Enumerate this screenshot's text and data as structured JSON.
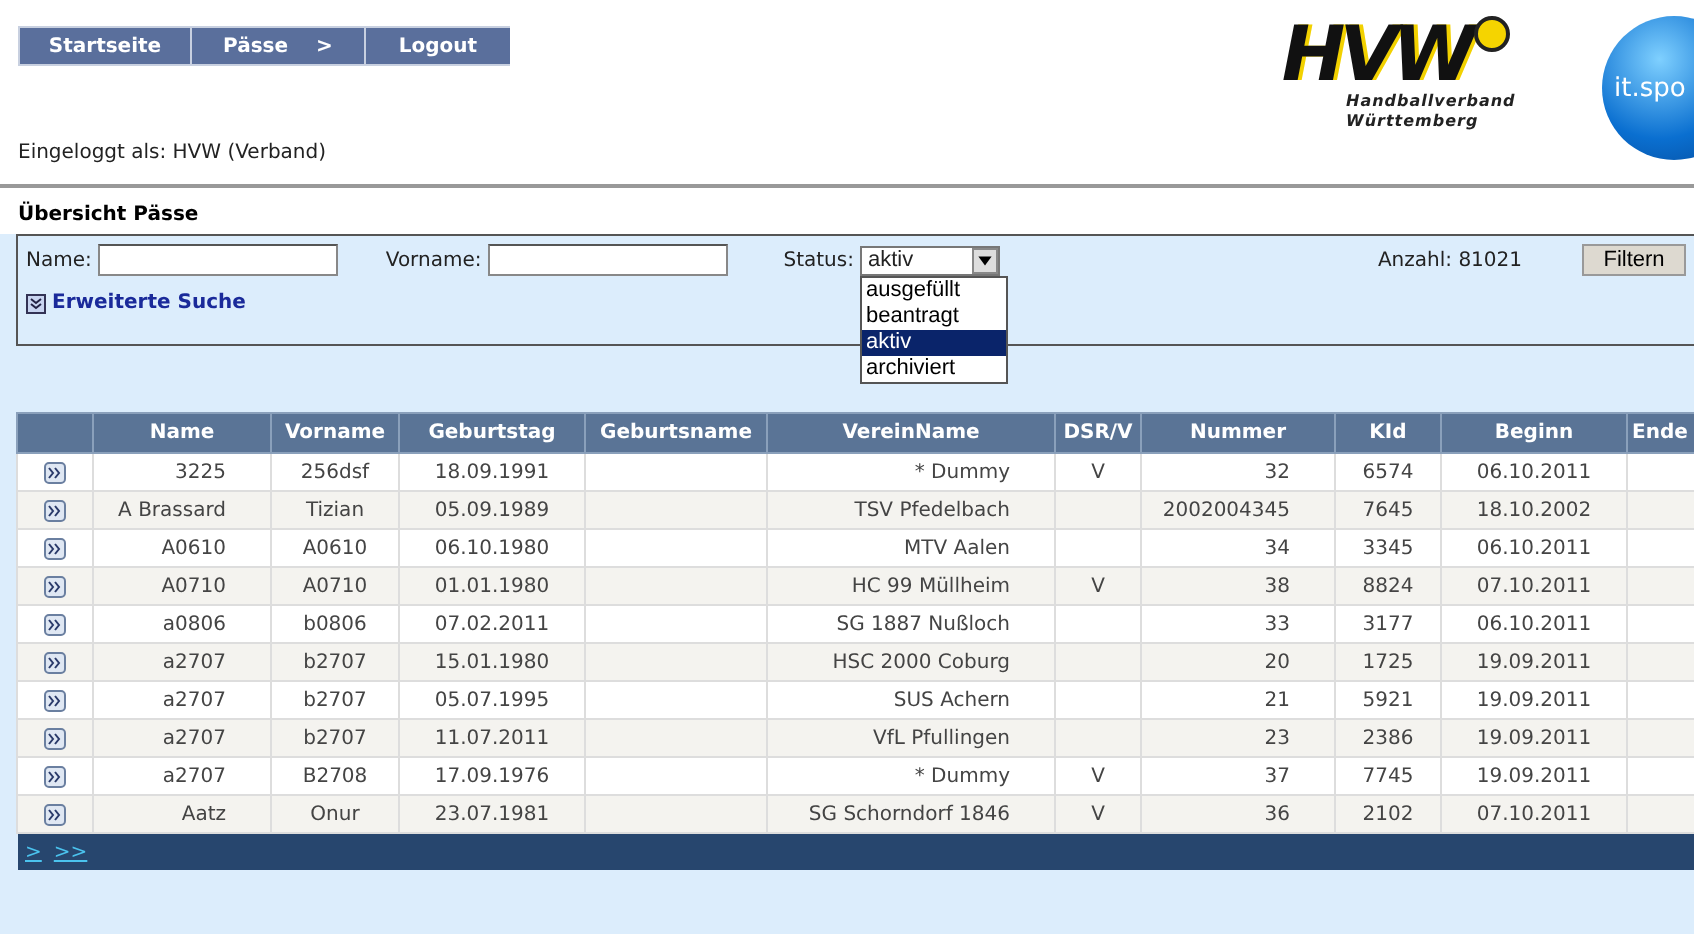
{
  "nav": [
    {
      "label": "Startseite"
    },
    {
      "label": "Pässe",
      "submenu": ">"
    },
    {
      "label": "Logout"
    }
  ],
  "login": "Eingeloggt als: HVW (Verband)",
  "logo": {
    "letters": "HVW",
    "line1": "Handballverband",
    "line2": "Württemberg",
    "partner": "it.spo"
  },
  "page_title": "Übersicht Pässe",
  "filter": {
    "name_label": "Name:",
    "vorname_label": "Vorname:",
    "status_label": "Status:",
    "status_value": "aktiv",
    "status_options": [
      {
        "label": "ausgefüllt",
        "selected": false
      },
      {
        "label": "beantragt",
        "selected": false
      },
      {
        "label": "aktiv",
        "selected": true
      },
      {
        "label": "archiviert",
        "selected": false
      }
    ],
    "count": "Anzahl: 81021",
    "button": "Filtern",
    "advanced": "Erweiterte Suche"
  },
  "table": {
    "columns": [
      "Name",
      "Vorname",
      "Geburtstag",
      "Geburtsname",
      "VereinName",
      "DSR/V",
      "Nummer",
      "KId",
      "Beginn",
      "Ende"
    ],
    "rows": [
      [
        "3225",
        "256dsf",
        "18.09.1991",
        "",
        "* Dummy",
        "V",
        "32",
        "6574",
        "06.10.2011",
        ""
      ],
      [
        "A Brassard",
        "Tizian",
        "05.09.1989",
        "",
        "TSV Pfedelbach",
        "",
        "2002004345",
        "7645",
        "18.10.2002",
        ""
      ],
      [
        "A0610",
        "A0610",
        "06.10.1980",
        "",
        "MTV Aalen",
        "",
        "34",
        "3345",
        "06.10.2011",
        ""
      ],
      [
        "A0710",
        "A0710",
        "01.01.1980",
        "",
        "HC 99 Müllheim",
        "V",
        "38",
        "8824",
        "07.10.2011",
        ""
      ],
      [
        "a0806",
        "b0806",
        "07.02.2011",
        "",
        "SG 1887 Nußloch",
        "",
        "33",
        "3177",
        "06.10.2011",
        ""
      ],
      [
        "a2707",
        "b2707",
        "15.01.1980",
        "",
        "HSC 2000 Coburg",
        "",
        "20",
        "1725",
        "19.09.2011",
        ""
      ],
      [
        "a2707",
        "b2707",
        "05.07.1995",
        "",
        "SUS Achern",
        "",
        "21",
        "5921",
        "19.09.2011",
        ""
      ],
      [
        "a2707",
        "b2707",
        "11.07.2011",
        "",
        "VfL Pfullingen",
        "",
        "23",
        "2386",
        "19.09.2011",
        ""
      ],
      [
        "a2707",
        "B2708",
        "17.09.1976",
        "",
        "* Dummy",
        "V",
        "37",
        "7745",
        "19.09.2011",
        ""
      ],
      [
        "Aatz",
        "Onur",
        "23.07.1981",
        "",
        "SG Schorndorf 1846",
        "V",
        "36",
        "2102",
        "07.10.2011",
        ""
      ]
    ]
  },
  "pager": [
    ">",
    ">>"
  ]
}
